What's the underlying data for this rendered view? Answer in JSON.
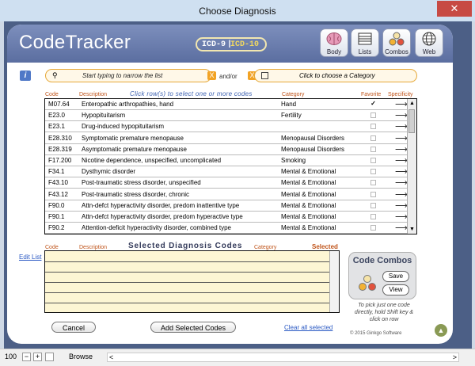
{
  "window": {
    "title": "Choose Diagnosis",
    "close_glyph": "✕"
  },
  "app": {
    "logo": "CodeTracker",
    "codeset": {
      "icd9": "ICD-9",
      "icd10": "ICD-10",
      "sep": "|"
    },
    "toolbar": [
      {
        "label": "Body",
        "icon": "brain-icon"
      },
      {
        "label": "Lists",
        "icon": "list-icon"
      },
      {
        "label": "Combos",
        "icon": "combos-icon"
      },
      {
        "label": "Web",
        "icon": "globe-icon"
      }
    ],
    "info_label": "i",
    "search": {
      "placeholder": "Start typing to narrow the list",
      "clear": "X"
    },
    "and_or": "and/or",
    "category_select": {
      "placeholder": "Click to choose a Category",
      "clear": "X"
    },
    "columns": {
      "code": "Code",
      "description": "Description",
      "category": "Category",
      "favorite": "Favorite",
      "specificity": "Specificity"
    },
    "hint": "Click row(s) to select one or more codes",
    "rows": [
      {
        "code": "M07.64",
        "desc": "Enteropathic arthropathies, hand",
        "cat": "Hand",
        "fav": true
      },
      {
        "code": "E23.0",
        "desc": "Hypopituitarism",
        "cat": "Fertility",
        "fav": false
      },
      {
        "code": "E23.1",
        "desc": "Drug-induced hypopituitarism",
        "cat": "",
        "fav": false
      },
      {
        "code": "E28.310",
        "desc": "Symptomatic premature menopause",
        "cat": "Menopausal Disorders",
        "fav": false
      },
      {
        "code": "E28.319",
        "desc": "Asymptomatic premature menopause",
        "cat": "Menopausal Disorders",
        "fav": false
      },
      {
        "code": "F17.200",
        "desc": "Nicotine dependence, unspecified, uncomplicated",
        "cat": "Smoking",
        "fav": false
      },
      {
        "code": "F34.1",
        "desc": "Dysthymic disorder",
        "cat": "Mental & Emotional",
        "fav": false
      },
      {
        "code": "F43.10",
        "desc": "Post-traumatic stress disorder, unspecified",
        "cat": "Mental & Emotional",
        "fav": false
      },
      {
        "code": "F43.12",
        "desc": "Post-traumatic stress disorder, chronic",
        "cat": "Mental & Emotional",
        "fav": false
      },
      {
        "code": "F90.0",
        "desc": "Attn-defct hyperactivity disorder, predom inattentive type",
        "cat": "Mental & Emotional",
        "fav": false
      },
      {
        "code": "F90.1",
        "desc": "Attn-defct hyperactivity disorder, predom hyperactive type",
        "cat": "Mental & Emotional",
        "fav": false
      },
      {
        "code": "F90.2",
        "desc": "Attention-deficit hyperactivity disorder, combined type",
        "cat": "Mental & Emotional",
        "fav": false
      }
    ],
    "fav_check": "✓",
    "spec_arrow": "⟶",
    "edit_list": "Edit List",
    "selected": {
      "title": "Selected Diagnosis Codes",
      "code": "Code",
      "description": "Description",
      "category": "Category",
      "selected_label": "Selected"
    },
    "combos": {
      "title": "Code Combos",
      "save": "Save",
      "view": "View",
      "colors": [
        "#f2b233",
        "#e2523d",
        "#f6e4a8"
      ]
    },
    "tip": "To pick just one code directly, hold Shift key & click on row",
    "cancel": "Cancel",
    "add_selected": "Add Selected Codes",
    "clear_all": "Clear all selected",
    "copyright": "© 2015 Ginkgo Software"
  },
  "statusbar": {
    "zoom": "100",
    "minus": "−",
    "plus": "+",
    "mode": "Browse",
    "nav_left": "<",
    "nav_right": ">"
  }
}
